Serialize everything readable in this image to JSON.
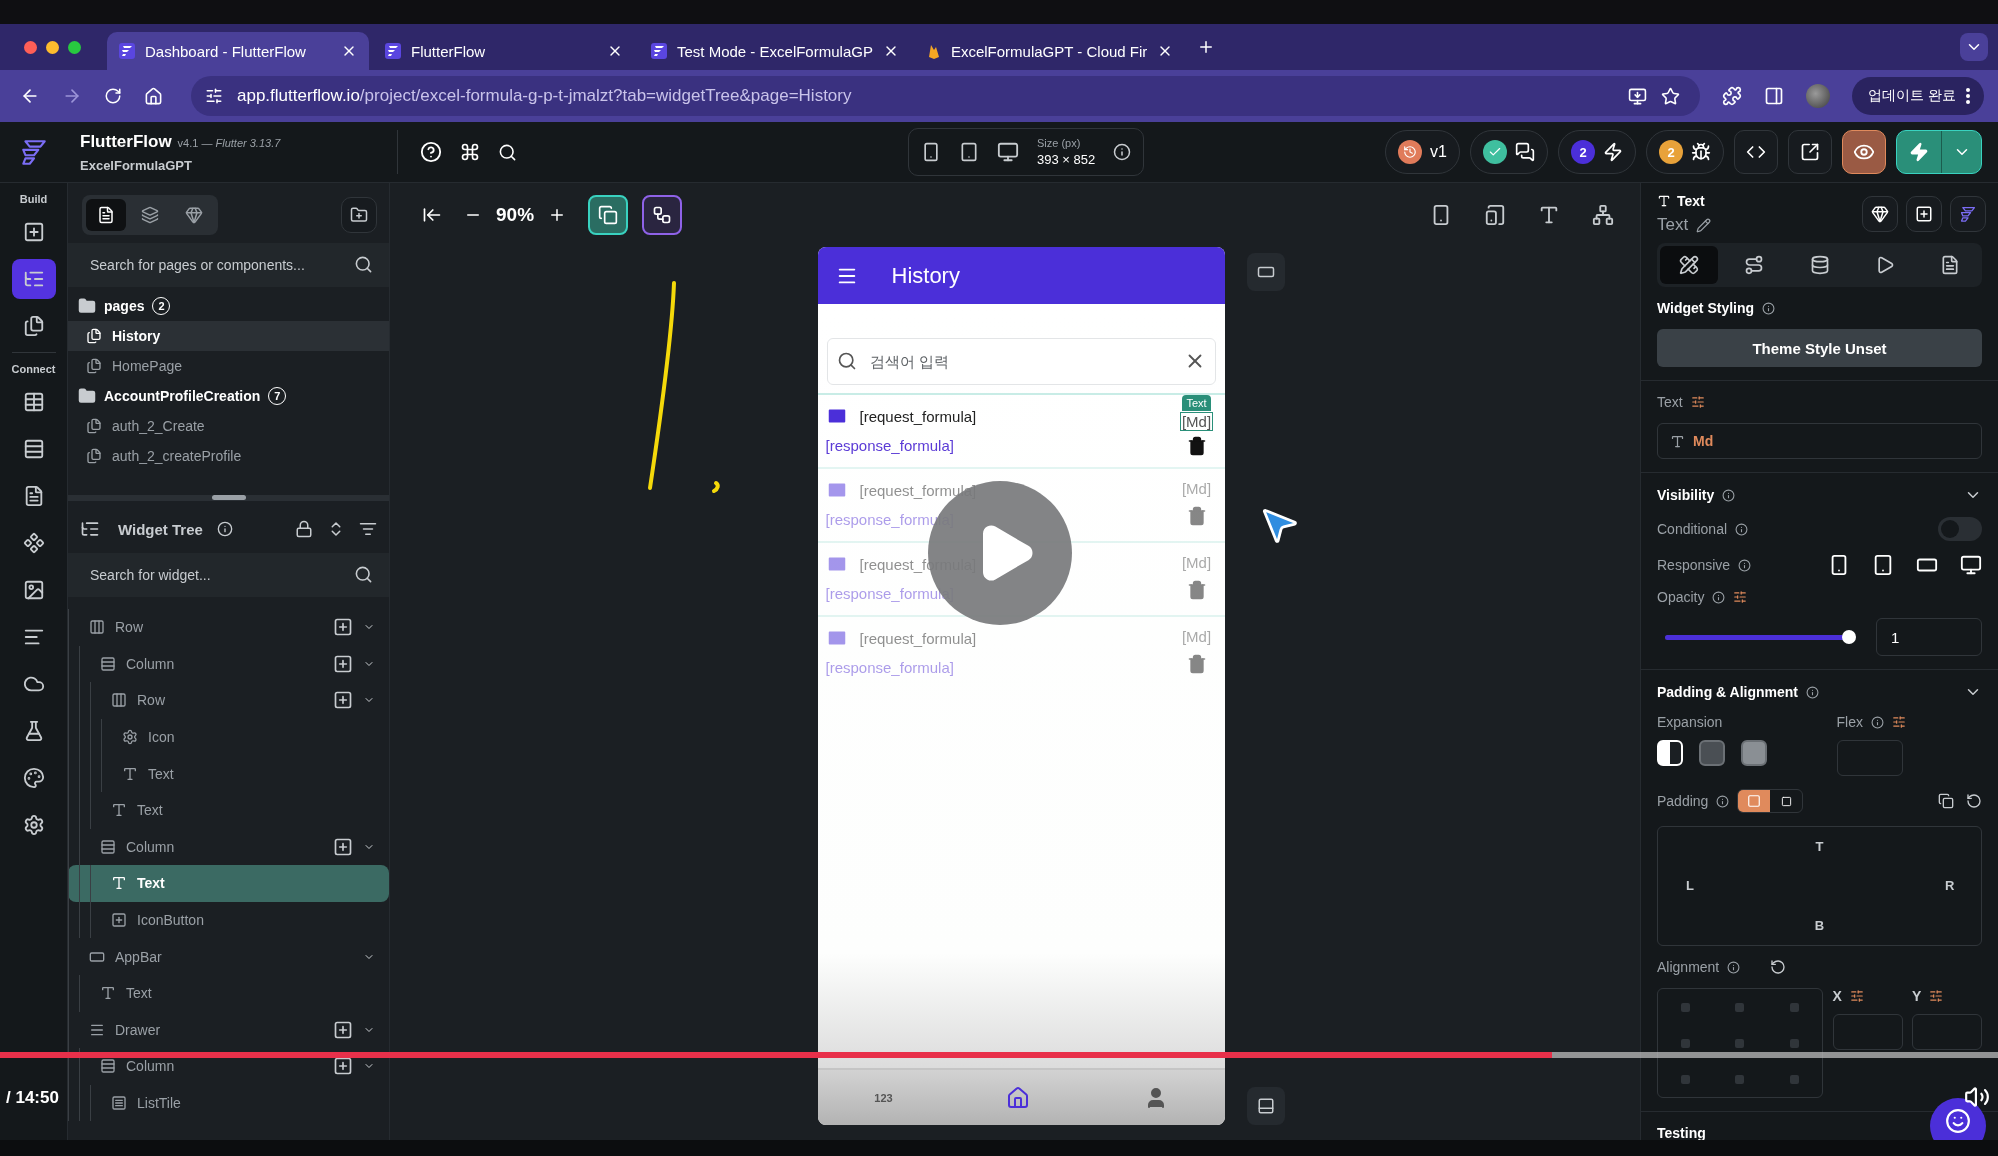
{
  "browser": {
    "tabs": [
      {
        "title": "Dashboard - FlutterFlow",
        "kind": "flutterflow",
        "selected": true
      },
      {
        "title": "FlutterFlow",
        "kind": "flutterflow",
        "selected": false
      },
      {
        "title": "Test Mode - ExcelFormulaGP",
        "kind": "flutterflow",
        "selected": false
      },
      {
        "title": "ExcelFormulaGPT - Cloud Fir",
        "kind": "firebase",
        "selected": false
      }
    ],
    "address": {
      "host": "app.flutterflow.io",
      "path": "/project/excel-formula-g-p-t-jmalzt?tab=widgetTree&page=History"
    },
    "update_button": "업데이트 완료"
  },
  "header": {
    "app_name": "FlutterFlow",
    "version": "v4.1 — *Flutter 3.13.7*",
    "project": "ExcelFormulaGPT",
    "size_label": "Size (px)",
    "size_value": "393 × 852",
    "actions": [
      {
        "kind": "version",
        "label": "v1"
      },
      {
        "kind": "status"
      },
      {
        "kind": "builds",
        "count": "2"
      },
      {
        "kind": "issues",
        "count": "2"
      },
      {
        "kind": "code"
      },
      {
        "kind": "open"
      },
      {
        "kind": "preview"
      },
      {
        "kind": "run"
      }
    ]
  },
  "rail": {
    "sections": [
      {
        "label": "Build",
        "items": [
          {
            "kind": "add-page",
            "selected": false
          },
          {
            "kind": "tree",
            "selected": true
          },
          {
            "kind": "storyboard",
            "selected": false
          }
        ]
      },
      {
        "label": "Connect",
        "items": [
          {
            "kind": "data",
            "selected": false
          },
          {
            "kind": "schema",
            "selected": false
          },
          {
            "kind": "files",
            "selected": false
          },
          {
            "kind": "components",
            "selected": false
          },
          {
            "kind": "media",
            "selected": false
          },
          {
            "kind": "text",
            "selected": false
          },
          {
            "kind": "cloud",
            "selected": false
          },
          {
            "kind": "tests",
            "selected": false
          },
          {
            "kind": "theme",
            "selected": false
          },
          {
            "kind": "settings",
            "selected": false
          }
        ]
      }
    ]
  },
  "left": {
    "page_tabs": [
      {
        "kind": "pages",
        "selected": true
      },
      {
        "kind": "components",
        "selected": false
      },
      {
        "kind": "library",
        "selected": false
      }
    ],
    "page_search": {
      "placeholder": "Search for pages or components..."
    },
    "page_groups": [
      {
        "name": "pages",
        "count": "2",
        "pages": [
          {
            "name": "History",
            "selected": true
          },
          {
            "name": "HomePage",
            "selected": false
          }
        ]
      },
      {
        "name": "AccountProfileCreation",
        "count": "7",
        "pages": [
          {
            "name": "auth_2_Create",
            "selected": false
          },
          {
            "name": "auth_2_createProfile",
            "selected": false
          }
        ]
      }
    ],
    "widget_tree": {
      "title": "Widget Tree",
      "search": {
        "placeholder": "Search for widget..."
      },
      "nodes": [
        {
          "label": "Row",
          "kind": "row",
          "selected": false,
          "add_child": true,
          "expandable": true,
          "children": [
            {
              "label": "Column",
              "kind": "column",
              "selected": false,
              "add_child": true,
              "expandable": true,
              "children": [
                {
                  "label": "Row",
                  "kind": "row",
                  "selected": false,
                  "add_child": true,
                  "expandable": true,
                  "children": [
                    {
                      "label": "Icon",
                      "kind": "icon",
                      "selected": false,
                      "add_child": false,
                      "expandable": false
                    },
                    {
                      "label": "Text",
                      "kind": "text",
                      "selected": false,
                      "add_child": false,
                      "expandable": false
                    }
                  ]
                },
                {
                  "label": "Text",
                  "kind": "text",
                  "selected": false,
                  "add_child": false,
                  "expandable": false
                }
              ]
            },
            {
              "label": "Column",
              "kind": "column",
              "selected": false,
              "add_child": true,
              "expandable": true,
              "children": [
                {
                  "label": "Text",
                  "kind": "text",
                  "selected": true,
                  "add_child": false,
                  "expandable": false
                },
                {
                  "label": "IconButton",
                  "kind": "iconbutton",
                  "selected": false,
                  "add_child": false,
                  "expandable": false
                }
              ]
            }
          ]
        },
        {
          "label": "AppBar",
          "kind": "appbar",
          "selected": false,
          "add_child": false,
          "expandable": true,
          "children": [
            {
              "label": "Text",
              "kind": "text",
              "selected": false,
              "add_child": false,
              "expandable": false
            }
          ]
        },
        {
          "label": "Drawer",
          "kind": "drawer",
          "selected": false,
          "add_child": true,
          "expandable": true,
          "children": [
            {
              "label": "Column",
              "kind": "column",
              "selected": false,
              "add_child": true,
              "expandable": true,
              "children": [
                {
                  "label": "ListTile",
                  "kind": "listtile",
                  "selected": false,
                  "add_child": false,
                  "expandable": false
                }
              ]
            }
          ]
        }
      ]
    }
  },
  "canvas": {
    "zoom": "90%",
    "phone": {
      "title": "History",
      "search": {
        "placeholder": "검색어 입력"
      },
      "selection_label": "Text",
      "items": [
        {
          "request": "[request_formula]",
          "response": "[response_formula]",
          "tag": "[Md]",
          "selected": true
        },
        {
          "request": "[request_formula]",
          "response": "[response_formula]",
          "tag": "[Md]",
          "selected": false
        },
        {
          "request": "[request_formula]",
          "response": "[response_formula]",
          "tag": "[Md]",
          "selected": false
        },
        {
          "request": "[request_formula]",
          "response": "[response_formula]",
          "tag": "[Md]",
          "selected": false
        }
      ],
      "nav": [
        {
          "kind": "numbers",
          "label": "123",
          "selected": false
        },
        {
          "kind": "home",
          "selected": true
        },
        {
          "kind": "person",
          "selected": false
        }
      ]
    }
  },
  "right": {
    "widget_type": "Text",
    "widget_name": "Text",
    "tabs": [
      {
        "kind": "style",
        "selected": true
      },
      {
        "kind": "actions",
        "selected": false
      },
      {
        "kind": "backend",
        "selected": false
      },
      {
        "kind": "animation",
        "selected": false
      },
      {
        "kind": "doc",
        "selected": false
      }
    ],
    "styling_title": "Widget Styling",
    "theme_button": "Theme Style Unset",
    "text_label": "Text",
    "text_value": "Md",
    "visibility": {
      "title": "Visibility",
      "expanded": true,
      "conditional_label": "Conditional",
      "conditional_on": false,
      "responsive_label": "Responsive",
      "opacity_label": "Opacity",
      "opacity": {
        "level": 1,
        "value": "1"
      }
    },
    "padding_alignment": {
      "title": "Padding & Alignment",
      "expanded": true,
      "expansion_label": "Expansion",
      "expansion": [
        {
          "kind": "fill",
          "selected": true
        },
        {
          "kind": "shrink",
          "selected": false
        },
        {
          "kind": "none",
          "selected": false
        }
      ],
      "flex_label": "Flex",
      "padding_label": "Padding",
      "padding_modes": [
        {
          "kind": "all",
          "selected": true
        },
        {
          "kind": "single",
          "selected": false
        }
      ],
      "sides": {
        "top": "T",
        "left": "L",
        "right": "R",
        "bottom": "B"
      },
      "alignment_label": "Alignment",
      "x_label": "X",
      "y_label": "Y"
    },
    "testing": "Testing"
  },
  "video": {
    "progress": {
      "level": 0.777
    },
    "time": "/ 14:50"
  }
}
